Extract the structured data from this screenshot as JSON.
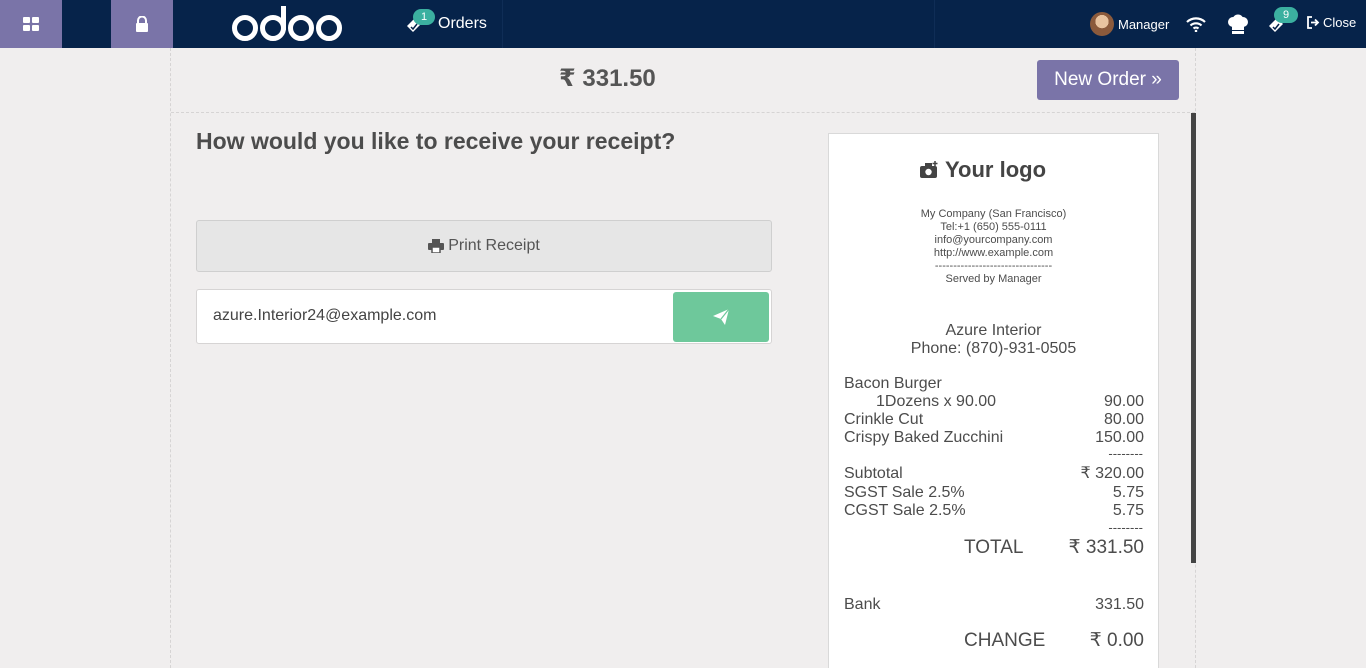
{
  "navbar": {
    "logo_text": "odoo",
    "orders_label": "Orders",
    "orders_badge": "1",
    "user_name": "Manager",
    "tickets_badge": "9",
    "close_label": "Close"
  },
  "header": {
    "total": "₹ 331.50",
    "new_order_label": "New Order »"
  },
  "main": {
    "question": "How would you like to receive your receipt?",
    "print_label": "Print Receipt",
    "email_value": "azure.Interior24@example.com"
  },
  "receipt": {
    "logo_text": "Your logo",
    "company": {
      "name": "My Company (San Francisco)",
      "tel": "Tel:+1 (650) 555-0111",
      "email": "info@yourcompany.com",
      "website": "http://www.example.com",
      "separator": "--------------------------------",
      "served_by": "Served by Manager"
    },
    "customer": {
      "name": "Azure Interior",
      "phone": "Phone: (870)-931-0505"
    },
    "lines": [
      {
        "name": "Bacon Burger",
        "detail": "1Dozens x 90.00",
        "amount": "90.00"
      },
      {
        "name": "Crinkle Cut",
        "amount": "80.00"
      },
      {
        "name": "Crispy Baked Zucchini",
        "amount": "150.00"
      }
    ],
    "dashes": "--------",
    "subtotal_label": "Subtotal",
    "subtotal_value": "₹ 320.00",
    "taxes": [
      {
        "label": "SGST Sale 2.5%",
        "value": "5.75"
      },
      {
        "label": "CGST Sale 2.5%",
        "value": "5.75"
      }
    ],
    "total_label": "TOTAL",
    "total_value": "₹ 331.50",
    "payment_label": "Bank",
    "payment_value": "331.50",
    "change_label": "CHANGE",
    "change_value": "₹ 0.00"
  },
  "colors": {
    "navbar": "#06234a",
    "accent": "#7a74a8",
    "send_button": "#6ec89b",
    "badge": "#3bb0a0"
  }
}
